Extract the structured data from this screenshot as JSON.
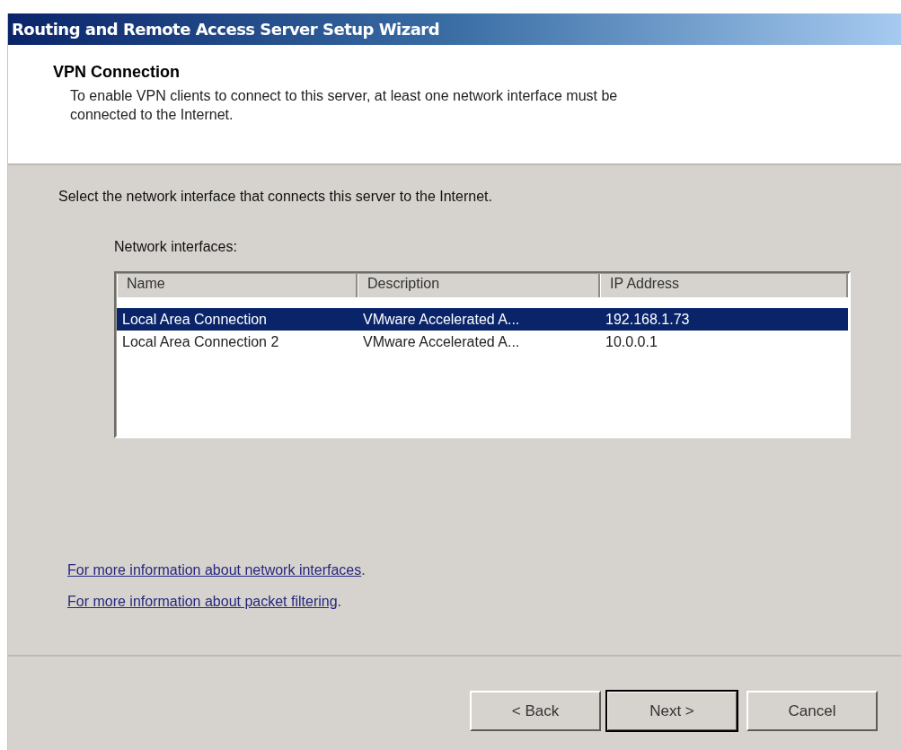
{
  "window": {
    "title": "Routing and Remote Access Server Setup Wizard"
  },
  "header": {
    "title": "VPN Connection",
    "description": "To enable VPN clients to connect to this server, at least one network interface must be connected to the Internet."
  },
  "instruction": "Select the network interface that connects this server to the Internet.",
  "list_label": "Network interfaces:",
  "table": {
    "columns": [
      "Name",
      "Description",
      "IP Address"
    ],
    "rows": [
      {
        "cells": [
          "Local Area Connection",
          "VMware Accelerated A...",
          "192.168.1.73"
        ],
        "selected": true
      },
      {
        "cells": [
          "Local Area Connection 2",
          "VMware Accelerated A...",
          "10.0.0.1"
        ],
        "selected": false
      }
    ]
  },
  "links": [
    {
      "text": "For more information about network interfaces",
      "suffix": "."
    },
    {
      "text": "For more information about packet filtering",
      "suffix": "."
    }
  ],
  "buttons": [
    {
      "label": "< Back",
      "default": false
    },
    {
      "label": "Next >",
      "default": true
    },
    {
      "label": "Cancel",
      "default": false
    }
  ]
}
